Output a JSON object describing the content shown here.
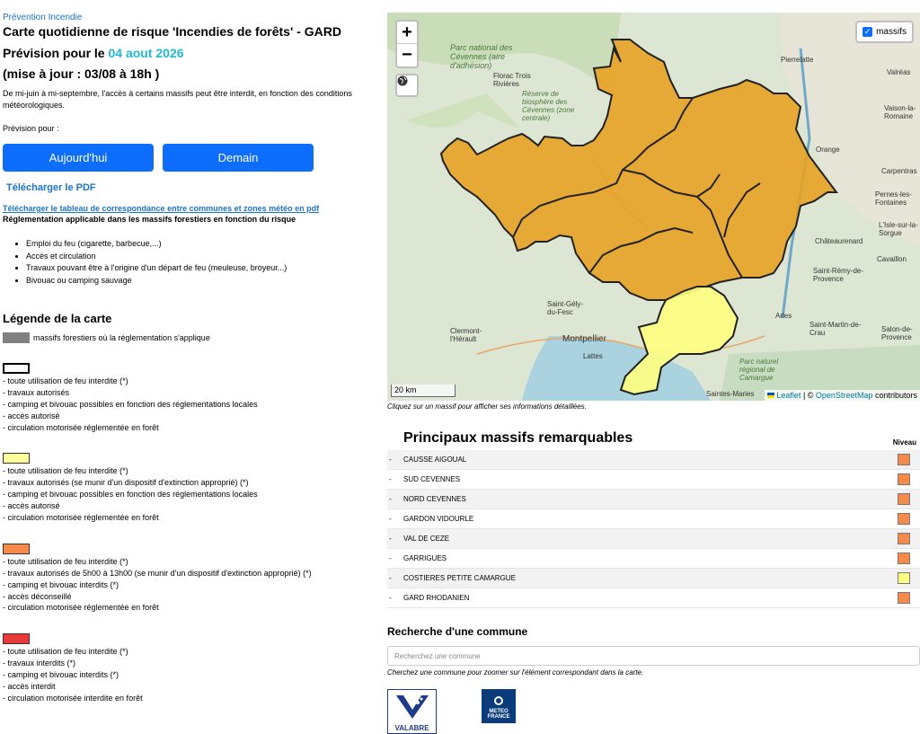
{
  "breadcrumb": "Prévention Incendie",
  "title": "Carte quotidienne de risque 'Incendies de forêts' - GARD",
  "forecast_prefix": "Prévision pour le ",
  "forecast_date": "04 aout 2026",
  "update": "(mise à jour : 03/08 à 18h )",
  "intro": "De mi-juin à mi-septembre, l'accès à certains massifs peut être interdit, en fonction des conditions météorologiques.",
  "prevision_label": "Prévision pour :",
  "buttons": {
    "today": "Aujourd'hui",
    "tomorrow": "Demain"
  },
  "pdf_link": "Télécharger le PDF",
  "table_link": "Télécharger le tableau de correspondance entre communes et zones météo en pdf",
  "regulation_title": "Réglementation applicable dans les massifs forestiers en fonction du risque",
  "rules": [
    "Emploi du feu (cigarette, barbecue,...)",
    "Accès et circulation",
    "Travaux pouvant être à l'origine d'un départ de feu (meuleuse, broyeur...)",
    "Bivouac ou camping sauvage"
  ],
  "legend": {
    "title": "Légende de la carte",
    "gray_label": "massifs forestiers où la réglementation s'applique",
    "colors": {
      "gray": "#808080",
      "white": "#ffffff",
      "yellow": "#ffff99",
      "orange": "#f58a4b",
      "red": "#e83a3a"
    },
    "levels": [
      {
        "color": "#ffffff",
        "lines": [
          "- toute utilisation de feu interdite (*)",
          "- travaux autorisés",
          "- camping et bivouac possibles en fonction des réglementations locales",
          "- accès autorisé",
          "- circulation motorisée réglementée en forêt"
        ]
      },
      {
        "color": "#ffff99",
        "lines": [
          "- toute utilisation de feu interdite (*)",
          "- travaux autorisés (se munir d'un dispositif d'extinction approprié) (*)",
          "- camping et bivouac possibles en fonction des réglementations locales",
          "- accès autorisé",
          "- circulation motorisée réglementée en forêt"
        ]
      },
      {
        "color": "#f58a4b",
        "lines": [
          "- toute utilisation de feu interdite (*)",
          "- travaux autorisés de 5h00 à 13h00 (se munir d'un dispositif d'extinction approprié) (*)",
          "- camping et bivouac interdits (*)",
          "- accès déconseillé",
          "- circulation motorisée réglementée en forêt"
        ]
      },
      {
        "color": "#e83a3a",
        "lines": [
          "- toute utilisation de feu interdite (*)",
          "- travaux interdits (*)",
          "- camping et bivouac interdits (*)",
          "- accès interdit",
          "- circulation motorisée interdite en forêt"
        ]
      }
    ]
  },
  "map": {
    "zoom_in": "+",
    "zoom_out": "−",
    "layer_label": "massifs",
    "scale": "20 km",
    "attribution_leaflet": "Leaflet",
    "attribution_sep": " | © ",
    "attribution_osm": "OpenStreetMap",
    "attribution_suffix": " contributors",
    "hint": "Cliquez sur un massif pour afficher ses informations détaillées.",
    "place_labels": [
      "Parc national des Cévennes (aire d'adhésion)",
      "Florac Trois Rivières",
      "Réserve de biosphère des Cévennes (zone centrale)",
      "Pierrelatte",
      "Valréas",
      "Vaison-la-Romaine",
      "Orange",
      "Carpentras",
      "Pernes-les-Fontaines",
      "L'Isle-sur-la-Sorgue",
      "Châteaurenard",
      "Cavaillon",
      "Saint-Rémy-de-Provence",
      "Arles",
      "Saint-Martin-de-Crau",
      "Salon-de-Provence",
      "Saint-Gély-du-Fesc",
      "Clermont-l'Hérault",
      "Montpellier",
      "Lattes",
      "Parc naturel régional de Camargue",
      "Saintes-Maries"
    ],
    "colors": {
      "orange_massif": "#e8a020",
      "yellow_massif": "#ffff80",
      "sea": "#aad3df"
    }
  },
  "massifs": {
    "title": "Principaux massifs remarquables",
    "level_header": "Niveau",
    "rows": [
      {
        "name": "CAUSSE AIGOUAL",
        "color": "#f58a4b"
      },
      {
        "name": "SUD CEVENNES",
        "color": "#f58a4b"
      },
      {
        "name": "NORD CEVENNES",
        "color": "#f58a4b"
      },
      {
        "name": "GARDON VIDOURLE",
        "color": "#f58a4b"
      },
      {
        "name": "VAL DE CEZE",
        "color": "#f58a4b"
      },
      {
        "name": "GARRIGUES",
        "color": "#f58a4b"
      },
      {
        "name": "COSTIERES PETITE CAMARGUE",
        "color": "#ffff80"
      },
      {
        "name": "GARD RHODANIEN",
        "color": "#f58a4b"
      }
    ]
  },
  "search": {
    "title": "Recherche d'une commune",
    "placeholder": "Recherchez une commune",
    "hint": "Cherchez une commune pour zoomer sur l'élément correspondant dans la carte."
  },
  "logos": {
    "valabre": "VALABRE",
    "meteo": "METEO FRANCE"
  }
}
